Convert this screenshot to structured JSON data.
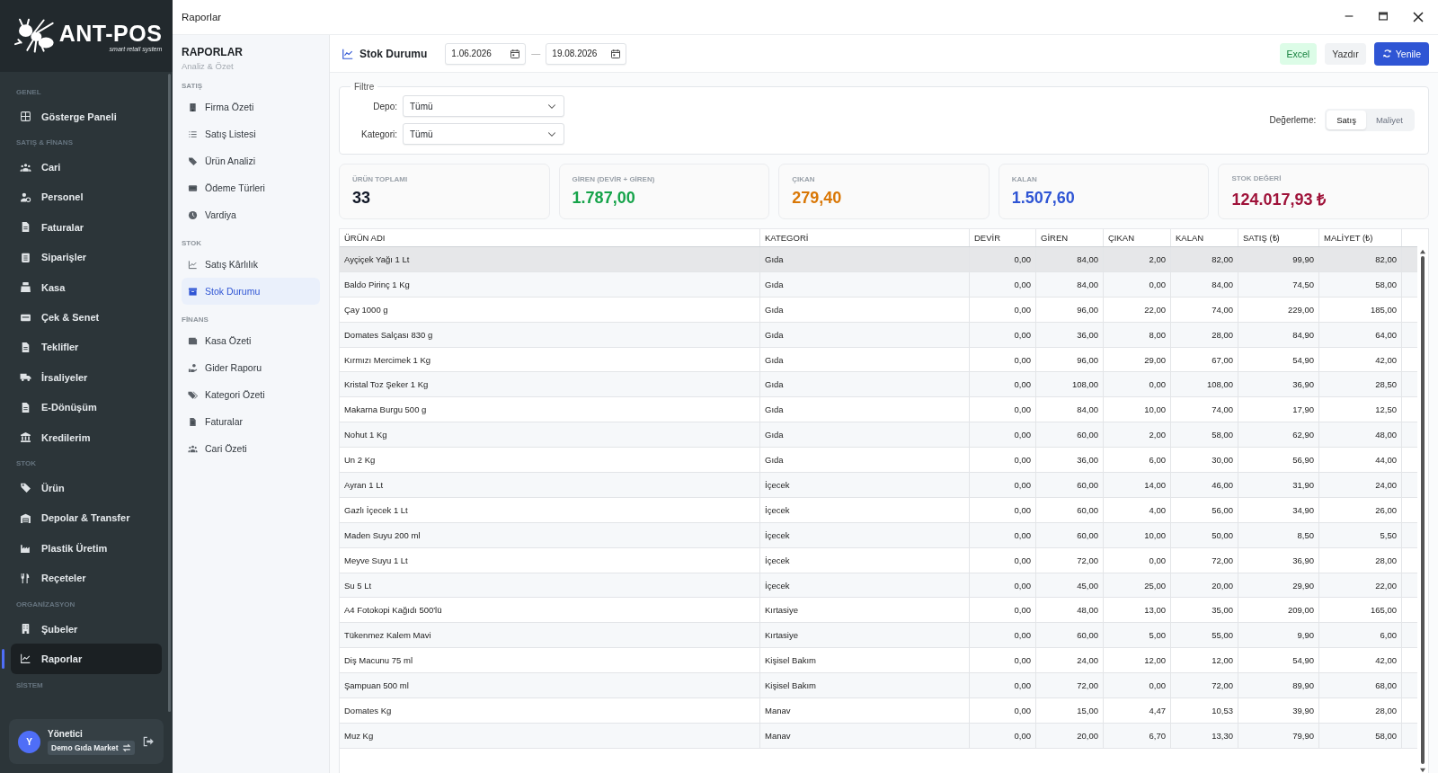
{
  "window": {
    "title": "Raporlar"
  },
  "sidebar": {
    "logo": {
      "name": "ANT-POS",
      "tagline": "smart retail system"
    },
    "sections": [
      {
        "label": "GENEL",
        "items": [
          {
            "label": "Gösterge Paneli",
            "selected": false
          }
        ]
      },
      {
        "label": "SATIŞ & FİNANS",
        "items": [
          {
            "label": "Cari",
            "selected": false
          },
          {
            "label": "Personel",
            "selected": false
          },
          {
            "label": "Faturalar",
            "selected": false
          },
          {
            "label": "Siparişler",
            "selected": false
          },
          {
            "label": "Kasa",
            "selected": false
          },
          {
            "label": "Çek & Senet",
            "selected": false
          },
          {
            "label": "Teklifler",
            "selected": false
          },
          {
            "label": "İrsaliyeler",
            "selected": false
          },
          {
            "label": "E-Dönüşüm",
            "selected": false
          },
          {
            "label": "Kredilerim",
            "selected": false
          }
        ]
      },
      {
        "label": "STOK",
        "items": [
          {
            "label": "Ürün",
            "selected": false
          },
          {
            "label": "Depolar & Transfer",
            "selected": false
          },
          {
            "label": "Plastik Üretim",
            "selected": false
          },
          {
            "label": "Reçeteler",
            "selected": false
          }
        ]
      },
      {
        "label": "ORGANİZASYON",
        "items": [
          {
            "label": "Şubeler",
            "selected": false
          },
          {
            "label": "Raporlar",
            "selected": true
          }
        ]
      },
      {
        "label": "SİSTEM"
      }
    ],
    "user": {
      "initial": "Y",
      "name": "Yönetici",
      "company": "Demo Gıda Market"
    }
  },
  "subnav": {
    "title": "RAPORLAR",
    "subtitle": "Analiz & Özet",
    "sections": [
      {
        "label": "SATIŞ",
        "items": [
          {
            "label": "Firma Özeti",
            "selected": false
          },
          {
            "label": "Satış Listesi",
            "selected": false
          },
          {
            "label": "Ürün Analizi",
            "selected": false
          },
          {
            "label": "Ödeme Türleri",
            "selected": false
          },
          {
            "label": "Vardiya",
            "selected": false
          }
        ]
      },
      {
        "label": "STOK",
        "items": [
          {
            "label": "Satış Kârlılık",
            "selected": false
          },
          {
            "label": "Stok Durumu",
            "selected": true
          }
        ]
      },
      {
        "label": "FİNANS",
        "items": [
          {
            "label": "Kasa Özeti",
            "selected": false
          },
          {
            "label": "Gider Raporu",
            "selected": false
          },
          {
            "label": "Kategori Özeti",
            "selected": false
          },
          {
            "label": "Faturalar",
            "selected": false
          },
          {
            "label": "Cari Özeti",
            "selected": false
          }
        ]
      }
    ]
  },
  "toolbar": {
    "title": "Stok Durumu",
    "date_from": "1.06.2026",
    "separator": "—",
    "date_to": "19.08.2026",
    "buttons": [
      {
        "label": "Excel",
        "kind": "excel"
      },
      {
        "label": "Yazdır",
        "kind": "plain"
      },
      {
        "label": "Yenile",
        "kind": "primary"
      }
    ]
  },
  "filter": {
    "legend": "Filtre",
    "fields": [
      {
        "label": "Depo:",
        "value": "Tümü"
      },
      {
        "label": "Kategori:",
        "value": "Tümü"
      }
    ],
    "valuation": {
      "label": "Değerleme:",
      "options": [
        {
          "label": "Satış",
          "selected": true
        },
        {
          "label": "Maliyet",
          "selected": false
        }
      ]
    }
  },
  "cards": [
    {
      "label": "ÜRÜN TOPLAMI",
      "value": "33",
      "color": "#111827"
    },
    {
      "label": "GİREN (DEVİR + GİREN)",
      "value": "1.787,00",
      "color": "#16a34a"
    },
    {
      "label": "ÇIKAN",
      "value": "279,40",
      "color": "#d97706"
    },
    {
      "label": "KALAN",
      "value": "1.507,60",
      "color": "#2f55d4"
    },
    {
      "label": "STOK DEĞERİ",
      "value": "124.017,93 ₺",
      "color": "#9f1239"
    }
  ],
  "table": {
    "columns": [
      "ÜRÜN ADI",
      "KATEGORİ",
      "DEVİR",
      "GİREN",
      "ÇIKAN",
      "KALAN",
      "SATIŞ (₺)",
      "MALİYET (₺)"
    ],
    "rows": [
      {
        "selected": true,
        "cells": [
          "Ayçiçek Yağı 1 Lt",
          "Gıda",
          "0,00",
          "84,00",
          "2,00",
          "82,00",
          "99,90",
          "82,00"
        ]
      },
      {
        "selected": false,
        "cells": [
          "Baldo Pirinç 1 Kg",
          "Gıda",
          "0,00",
          "84,00",
          "0,00",
          "84,00",
          "74,50",
          "58,00"
        ]
      },
      {
        "selected": false,
        "cells": [
          "Çay 1000 g",
          "Gıda",
          "0,00",
          "96,00",
          "22,00",
          "74,00",
          "229,00",
          "185,00"
        ]
      },
      {
        "selected": false,
        "cells": [
          "Domates Salçası 830 g",
          "Gıda",
          "0,00",
          "36,00",
          "8,00",
          "28,00",
          "84,90",
          "64,00"
        ]
      },
      {
        "selected": false,
        "cells": [
          "Kırmızı Mercimek 1 Kg",
          "Gıda",
          "0,00",
          "96,00",
          "29,00",
          "67,00",
          "54,90",
          "42,00"
        ]
      },
      {
        "selected": false,
        "cells": [
          "Kristal Toz Şeker 1 Kg",
          "Gıda",
          "0,00",
          "108,00",
          "0,00",
          "108,00",
          "36,90",
          "28,50"
        ]
      },
      {
        "selected": false,
        "cells": [
          "Makarna Burgu 500 g",
          "Gıda",
          "0,00",
          "84,00",
          "10,00",
          "74,00",
          "17,90",
          "12,50"
        ]
      },
      {
        "selected": false,
        "cells": [
          "Nohut 1 Kg",
          "Gıda",
          "0,00",
          "60,00",
          "2,00",
          "58,00",
          "62,90",
          "48,00"
        ]
      },
      {
        "selected": false,
        "cells": [
          "Un 2 Kg",
          "Gıda",
          "0,00",
          "36,00",
          "6,00",
          "30,00",
          "56,90",
          "44,00"
        ]
      },
      {
        "selected": false,
        "cells": [
          "Ayran 1 Lt",
          "İçecek",
          "0,00",
          "60,00",
          "14,00",
          "46,00",
          "31,90",
          "24,00"
        ]
      },
      {
        "selected": false,
        "cells": [
          "Gazlı İçecek 1 Lt",
          "İçecek",
          "0,00",
          "60,00",
          "4,00",
          "56,00",
          "34,90",
          "26,00"
        ]
      },
      {
        "selected": false,
        "cells": [
          "Maden Suyu 200 ml",
          "İçecek",
          "0,00",
          "60,00",
          "10,00",
          "50,00",
          "8,50",
          "5,50"
        ]
      },
      {
        "selected": false,
        "cells": [
          "Meyve Suyu 1 Lt",
          "İçecek",
          "0,00",
          "72,00",
          "0,00",
          "72,00",
          "36,90",
          "28,00"
        ]
      },
      {
        "selected": false,
        "cells": [
          "Su 5 Lt",
          "İçecek",
          "0,00",
          "45,00",
          "25,00",
          "20,00",
          "29,90",
          "22,00"
        ]
      },
      {
        "selected": false,
        "cells": [
          "A4 Fotokopi Kağıdı 500'lü",
          "Kırtasiye",
          "0,00",
          "48,00",
          "13,00",
          "35,00",
          "209,00",
          "165,00"
        ]
      },
      {
        "selected": false,
        "cells": [
          "Tükenmez Kalem Mavi",
          "Kırtasiye",
          "0,00",
          "60,00",
          "5,00",
          "55,00",
          "9,90",
          "6,00"
        ]
      },
      {
        "selected": false,
        "cells": [
          "Diş Macunu 75 ml",
          "Kişisel Bakım",
          "0,00",
          "24,00",
          "12,00",
          "12,00",
          "54,90",
          "42,00"
        ]
      },
      {
        "selected": false,
        "cells": [
          "Şampuan 500 ml",
          "Kişisel Bakım",
          "0,00",
          "72,00",
          "0,00",
          "72,00",
          "89,90",
          "68,00"
        ]
      },
      {
        "selected": false,
        "cells": [
          "Domates Kg",
          "Manav",
          "0,00",
          "15,00",
          "4,47",
          "10,53",
          "39,90",
          "28,00"
        ]
      },
      {
        "selected": false,
        "cells": [
          "Muz Kg",
          "Manav",
          "0,00",
          "20,00",
          "6,70",
          "13,30",
          "79,90",
          "58,00"
        ]
      }
    ]
  }
}
